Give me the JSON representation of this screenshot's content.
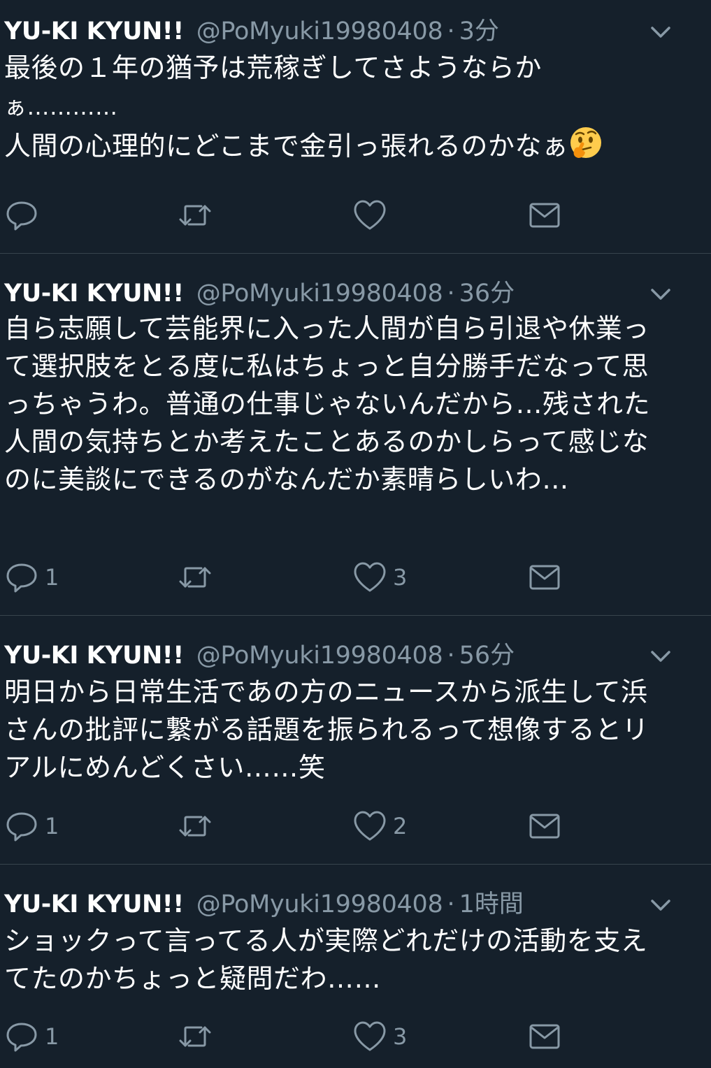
{
  "tweets": [
    {
      "name": "YU-KI KYUN!!",
      "handle": "@PoMyuki19980408",
      "dot": "·",
      "time": "3分",
      "text_line1": "最後の１年の猶予は荒稼ぎしてさようならか",
      "text_line2": "ぁ…………",
      "text_line3": "人間の心理的にどこまで金引っ張れるのかなぁ",
      "emoji": "thinking-face-emoji",
      "reply_count": "",
      "retweet_count": "",
      "like_count": ""
    },
    {
      "name": "YU-KI KYUN!!",
      "handle": "@PoMyuki19980408",
      "dot": "·",
      "time": "36分",
      "text": "自ら志願して芸能界に入った人間が自ら引退や休業って選択肢をとる度に私はちょっと自分勝手だなって思っちゃうわ。普通の仕事じゃないんだから…残された人間の気持ちとか考えたことあるのかしらって感じなのに美談にできるのがなんだか素晴らしいわ…",
      "reply_count": "1",
      "retweet_count": "",
      "like_count": "3"
    },
    {
      "name": "YU-KI KYUN!!",
      "handle": "@PoMyuki19980408",
      "dot": "·",
      "time": "56分",
      "text": "明日から日常生活であの方のニュースから派生して浜さんの批評に繋がる話題を振られるって想像するとリアルにめんどくさい……笑",
      "reply_count": "1",
      "retweet_count": "",
      "like_count": "2"
    },
    {
      "name": "YU-KI KYUN!!",
      "handle": "@PoMyuki19980408",
      "dot": "·",
      "time": "1時間",
      "text": "ショックって言ってる人が実際どれだけの活動を支えてたのかちょっと疑問だわ……",
      "reply_count": "1",
      "retweet_count": "",
      "like_count": "3"
    }
  ],
  "icons": {
    "reply": "reply-icon",
    "retweet": "retweet-icon",
    "like": "like-icon",
    "dm": "direct-message-icon",
    "caret": "chevron-down-icon"
  },
  "colors": {
    "background": "#15202b",
    "primary_text": "#ffffff",
    "secondary_text": "#8899a6",
    "divider": "#38444d"
  }
}
